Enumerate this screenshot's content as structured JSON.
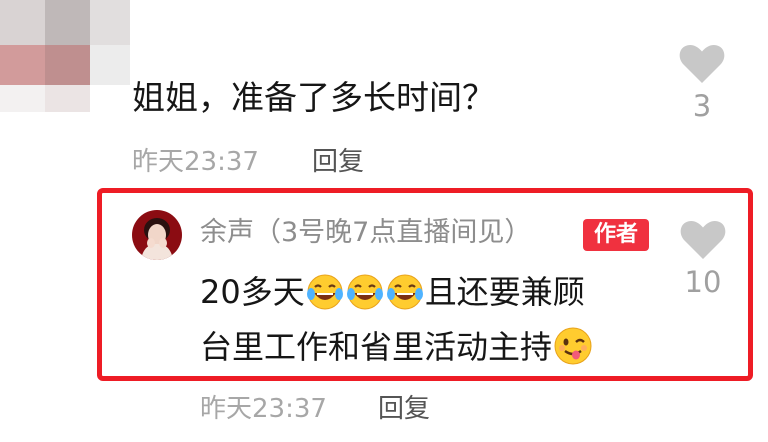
{
  "comment1": {
    "text": "姐姐，准备了多长时间？",
    "time": "昨天23:37",
    "reply_label": "回复",
    "likes": "3"
  },
  "comment2": {
    "username": "余声（3号晚7点直播间见）",
    "badge": "作者",
    "line1_start": "20多天",
    "line1_end": "且还要兼顾",
    "line2": "台里工作和省里活动主持",
    "emojis_line1": [
      "laughing-crying-emoji",
      "laughing-crying-emoji",
      "laughing-crying-emoji"
    ],
    "emoji_line2": "winking-tongue-emoji",
    "time": "昨天23:37",
    "reply_label": "回复",
    "likes": "10"
  },
  "colors": {
    "highlight_border": "#ee1c25",
    "badge_bg": "#f0313f",
    "heart": "#c8c8c8"
  }
}
